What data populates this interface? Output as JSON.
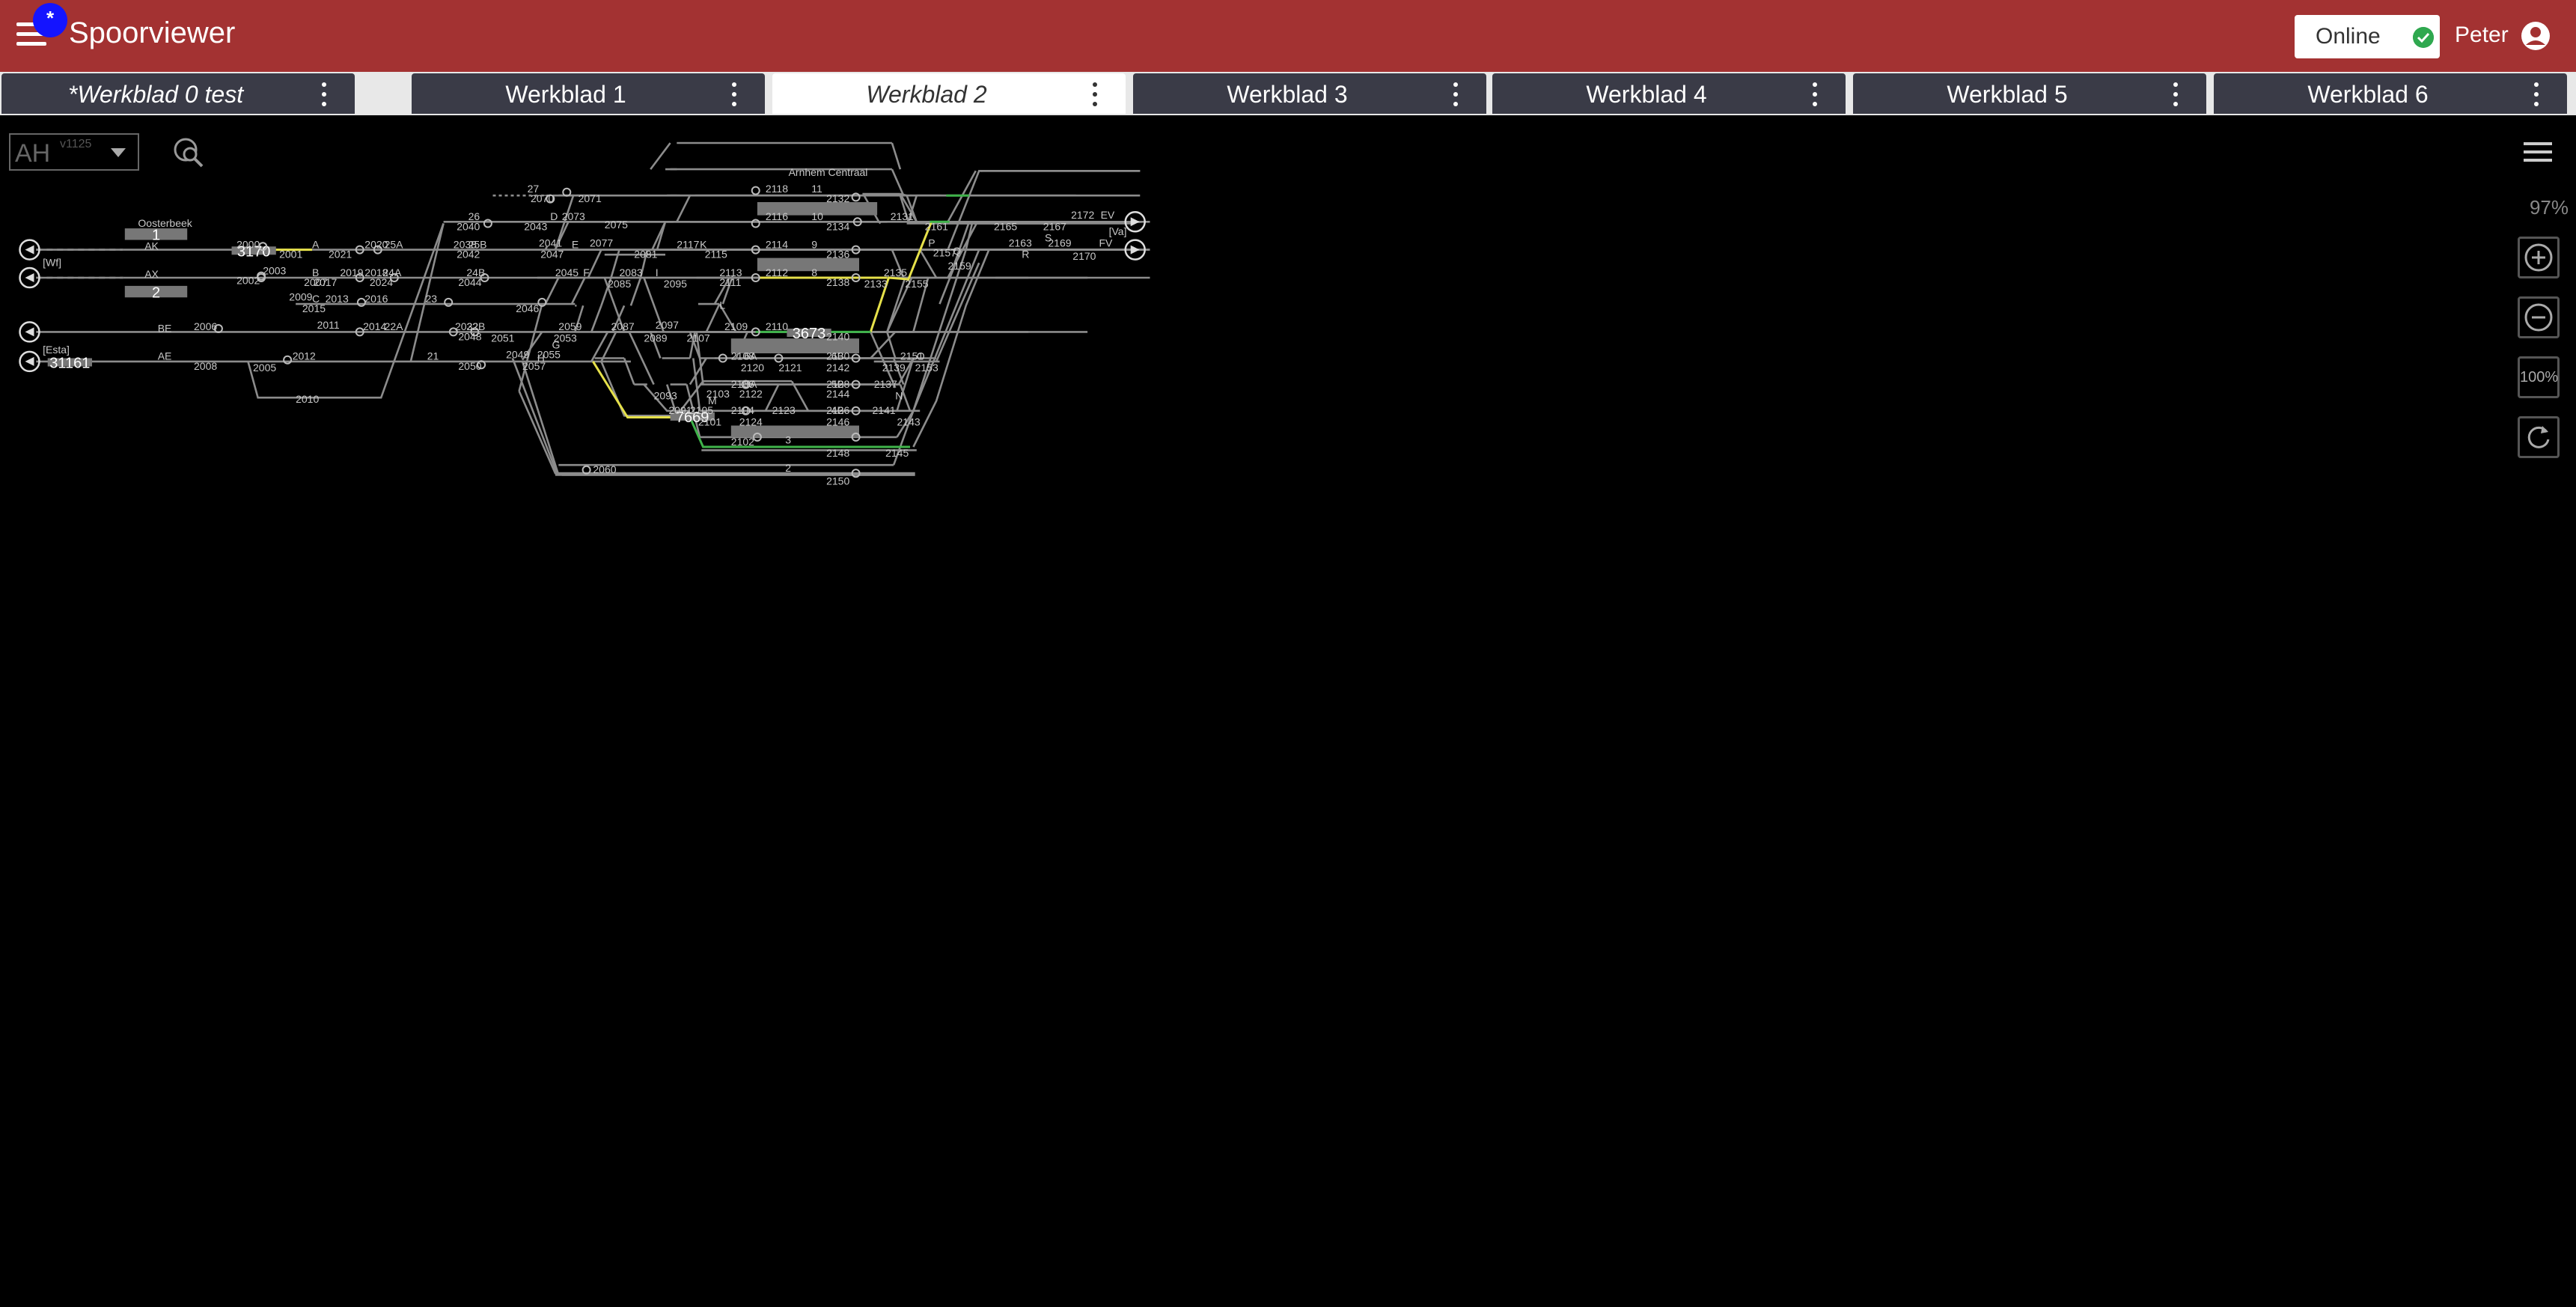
{
  "app": {
    "title": "Spoorviewer",
    "badge": "*"
  },
  "status": {
    "label": "Online"
  },
  "user": {
    "name": "Peter"
  },
  "tabs": [
    {
      "label": "*Werkblad 0 test",
      "active": false
    },
    {
      "label": "Werkblad 1",
      "active": false
    },
    {
      "label": "Werkblad 2",
      "active": true
    },
    {
      "label": "Werkblad 3",
      "active": false
    },
    {
      "label": "Werkblad 4",
      "active": false
    },
    {
      "label": "Werkblad 5",
      "active": false
    },
    {
      "label": "Werkblad 6",
      "active": false
    }
  ],
  "selector": {
    "value": "AH",
    "version": "v1125"
  },
  "zoom": {
    "level": "97%",
    "reset_label": "100%"
  },
  "colors": {
    "appbar": "#a33232",
    "track": "#8c8c8c",
    "route_yellow": "#e6e14a",
    "route_green": "#3fb34a",
    "train_box": "#777777"
  },
  "diagram": {
    "station_arnhem": "Arnhem Centraal",
    "station_oosterbeek": "Oosterbeek",
    "platforms": [
      "1",
      "2"
    ],
    "trains": [
      "3170",
      "31161",
      "3673",
      "7669"
    ],
    "labels": [
      "AK",
      "AX",
      "BE",
      "AE",
      "[Wf]",
      "[Esta]",
      "[Va]",
      "EV",
      "FV",
      "2000",
      "2001",
      "2002",
      "2003",
      "2005",
      "2006",
      "2007",
      "2008",
      "2009",
      "2010",
      "2011",
      "2012",
      "2013",
      "2014",
      "2015",
      "2016",
      "2017",
      "2018",
      "2019",
      "2020",
      "2021",
      "22A",
      "22B",
      "23",
      "24A",
      "24B",
      "25A",
      "25B",
      "26",
      "27",
      "21",
      "2024",
      "2032",
      "2038",
      "2040",
      "2041",
      "2042",
      "2043",
      "2044",
      "2045",
      "2046",
      "2047",
      "2048",
      "2049",
      "2050",
      "2051",
      "2053",
      "2055",
      "2057",
      "2059",
      "2060",
      "2070",
      "2071",
      "2073",
      "2075",
      "2077",
      "2081",
      "2083",
      "2085",
      "2087",
      "2089",
      "2091",
      "2093",
      "2095",
      "2097",
      "2101",
      "2102",
      "2103",
      "2104",
      "2105",
      "2106",
      "2107",
      "2108",
      "2109",
      "2110",
      "2111",
      "2112",
      "2113",
      "2114",
      "2115",
      "2116",
      "2117",
      "2118",
      "2120",
      "2121",
      "2122",
      "2123",
      "2124",
      "2126",
      "2128",
      "2130",
      "2131",
      "2132",
      "2133",
      "2134",
      "2135",
      "2136",
      "2137",
      "2138",
      "2139",
      "2140",
      "2141",
      "2142",
      "2143",
      "2144",
      "2145",
      "2146",
      "2148",
      "2150",
      "2151",
      "2153",
      "2155",
      "2157",
      "2159",
      "2161",
      "2163",
      "2165",
      "2167",
      "2169",
      "2170",
      "2172",
      "A",
      "B",
      "C",
      "D",
      "E",
      "F",
      "G",
      "H",
      "I",
      "K",
      "L",
      "M",
      "N",
      "O",
      "P",
      "Q",
      "R",
      "S",
      "2",
      "3",
      "4B",
      "5A",
      "5B",
      "6A",
      "6B",
      "8",
      "9",
      "10",
      "11"
    ]
  }
}
